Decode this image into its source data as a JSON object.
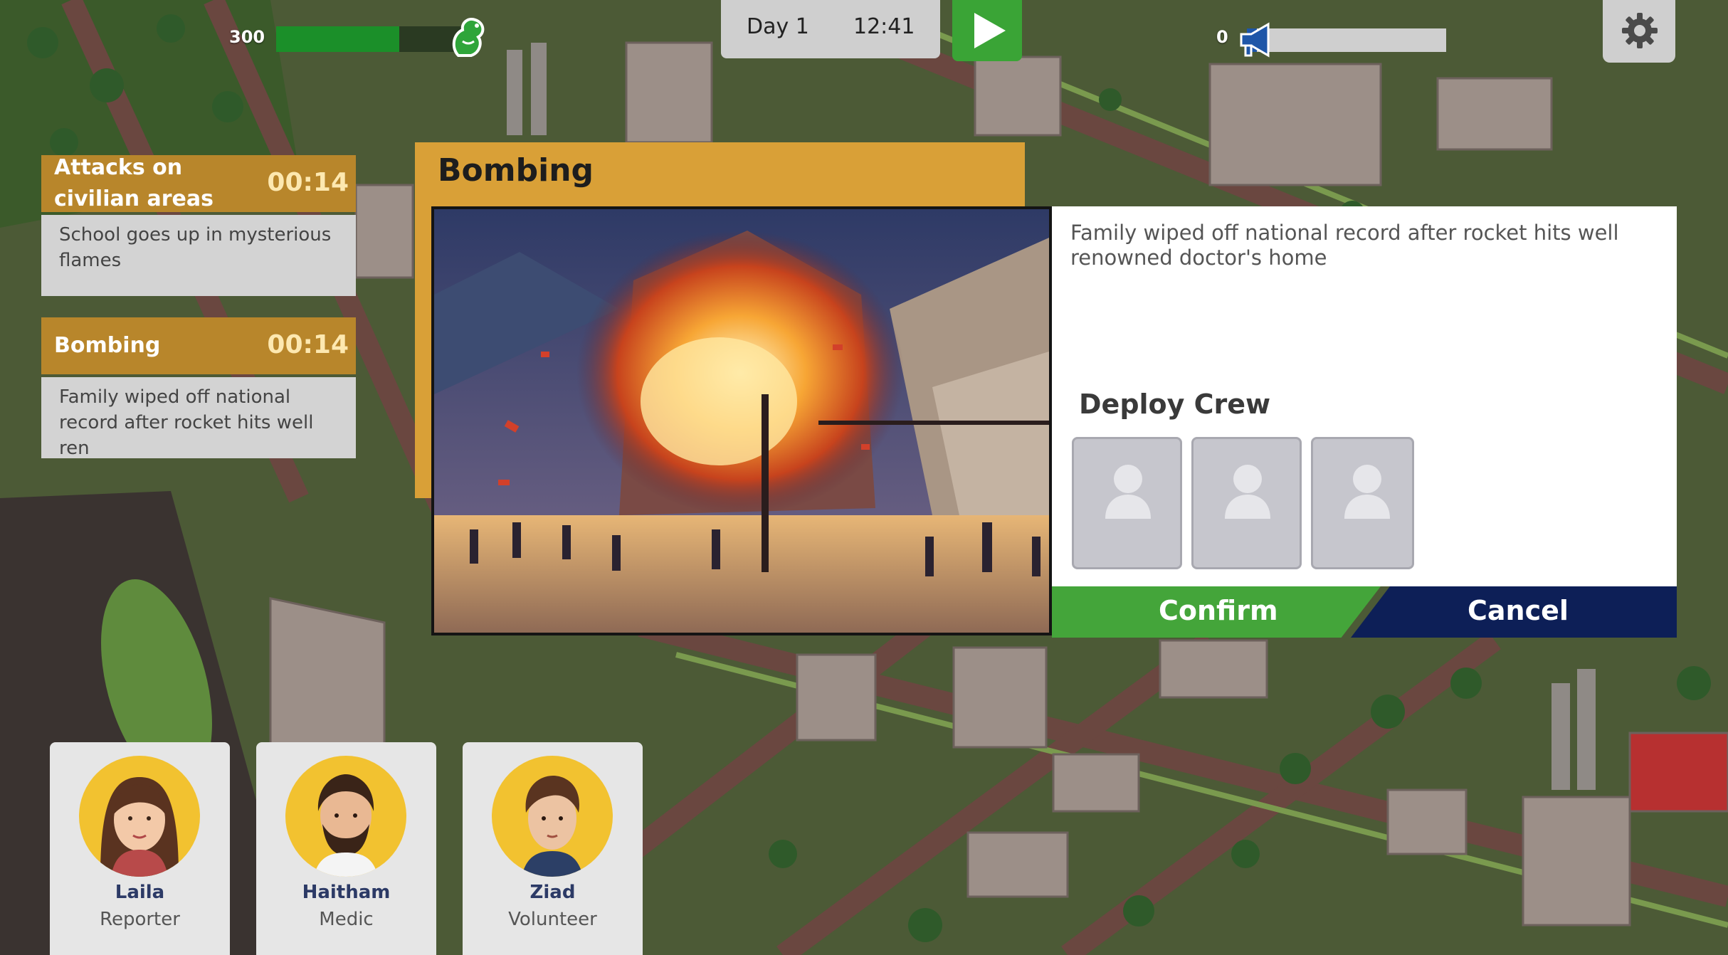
{
  "hud": {
    "health_value": "300",
    "health_fraction": 0.64,
    "day_label": "Day 1",
    "clock": "12:41",
    "media_value": "0",
    "media_fraction": 0.05,
    "icons": {
      "health": "dinosaur-icon",
      "media": "megaphone-icon",
      "play": "play-icon",
      "settings": "gear-icon"
    }
  },
  "events": [
    {
      "title": "Attacks on civilian areas",
      "timer": "00:14",
      "summary": "School goes up in mysterious flames"
    },
    {
      "title": "Bombing",
      "timer": "00:14",
      "summary": "Family wiped off national record after rocket hits well ren"
    }
  ],
  "modal": {
    "title": "Bombing",
    "description": "Family wiped off national record after rocket hits well renowned doctor's home",
    "deploy_label": "Deploy Crew",
    "crew_slot_count": 3,
    "confirm_label": "Confirm",
    "cancel_label": "Cancel"
  },
  "crew": [
    {
      "name": "Laila",
      "role": "Reporter"
    },
    {
      "name": "Haitham",
      "role": "Medic"
    },
    {
      "name": "Ziad",
      "role": "Volunteer"
    }
  ],
  "colors": {
    "accent": "#d9a037",
    "event_header": "#b8862b",
    "confirm": "#44a53a",
    "cancel": "#0d1f57",
    "health": "#1b8f29",
    "media": "#1e56a8",
    "avatar_bg": "#f2c230"
  }
}
